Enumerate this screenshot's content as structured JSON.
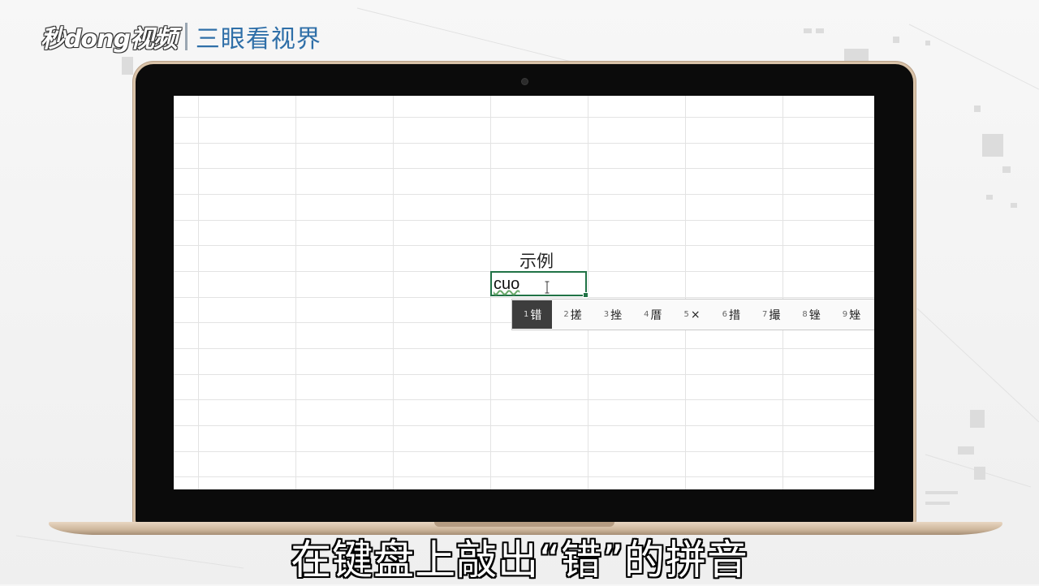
{
  "watermark": {
    "logo": "秒dong视频",
    "brand": "三眼看视界"
  },
  "sheet": {
    "label_cell": "示例",
    "active_cell_text": "cuo"
  },
  "ime": {
    "candidates": [
      {
        "num": "1",
        "char": "错"
      },
      {
        "num": "2",
        "char": "搓"
      },
      {
        "num": "3",
        "char": "挫"
      },
      {
        "num": "4",
        "char": "厝"
      },
      {
        "num": "5",
        "char": "×"
      },
      {
        "num": "6",
        "char": "措"
      },
      {
        "num": "7",
        "char": "撮"
      },
      {
        "num": "8",
        "char": "锉"
      },
      {
        "num": "9",
        "char": "矬"
      }
    ],
    "selected_index": 0
  },
  "subtitle": "在键盘上敲出“错”的拼音"
}
